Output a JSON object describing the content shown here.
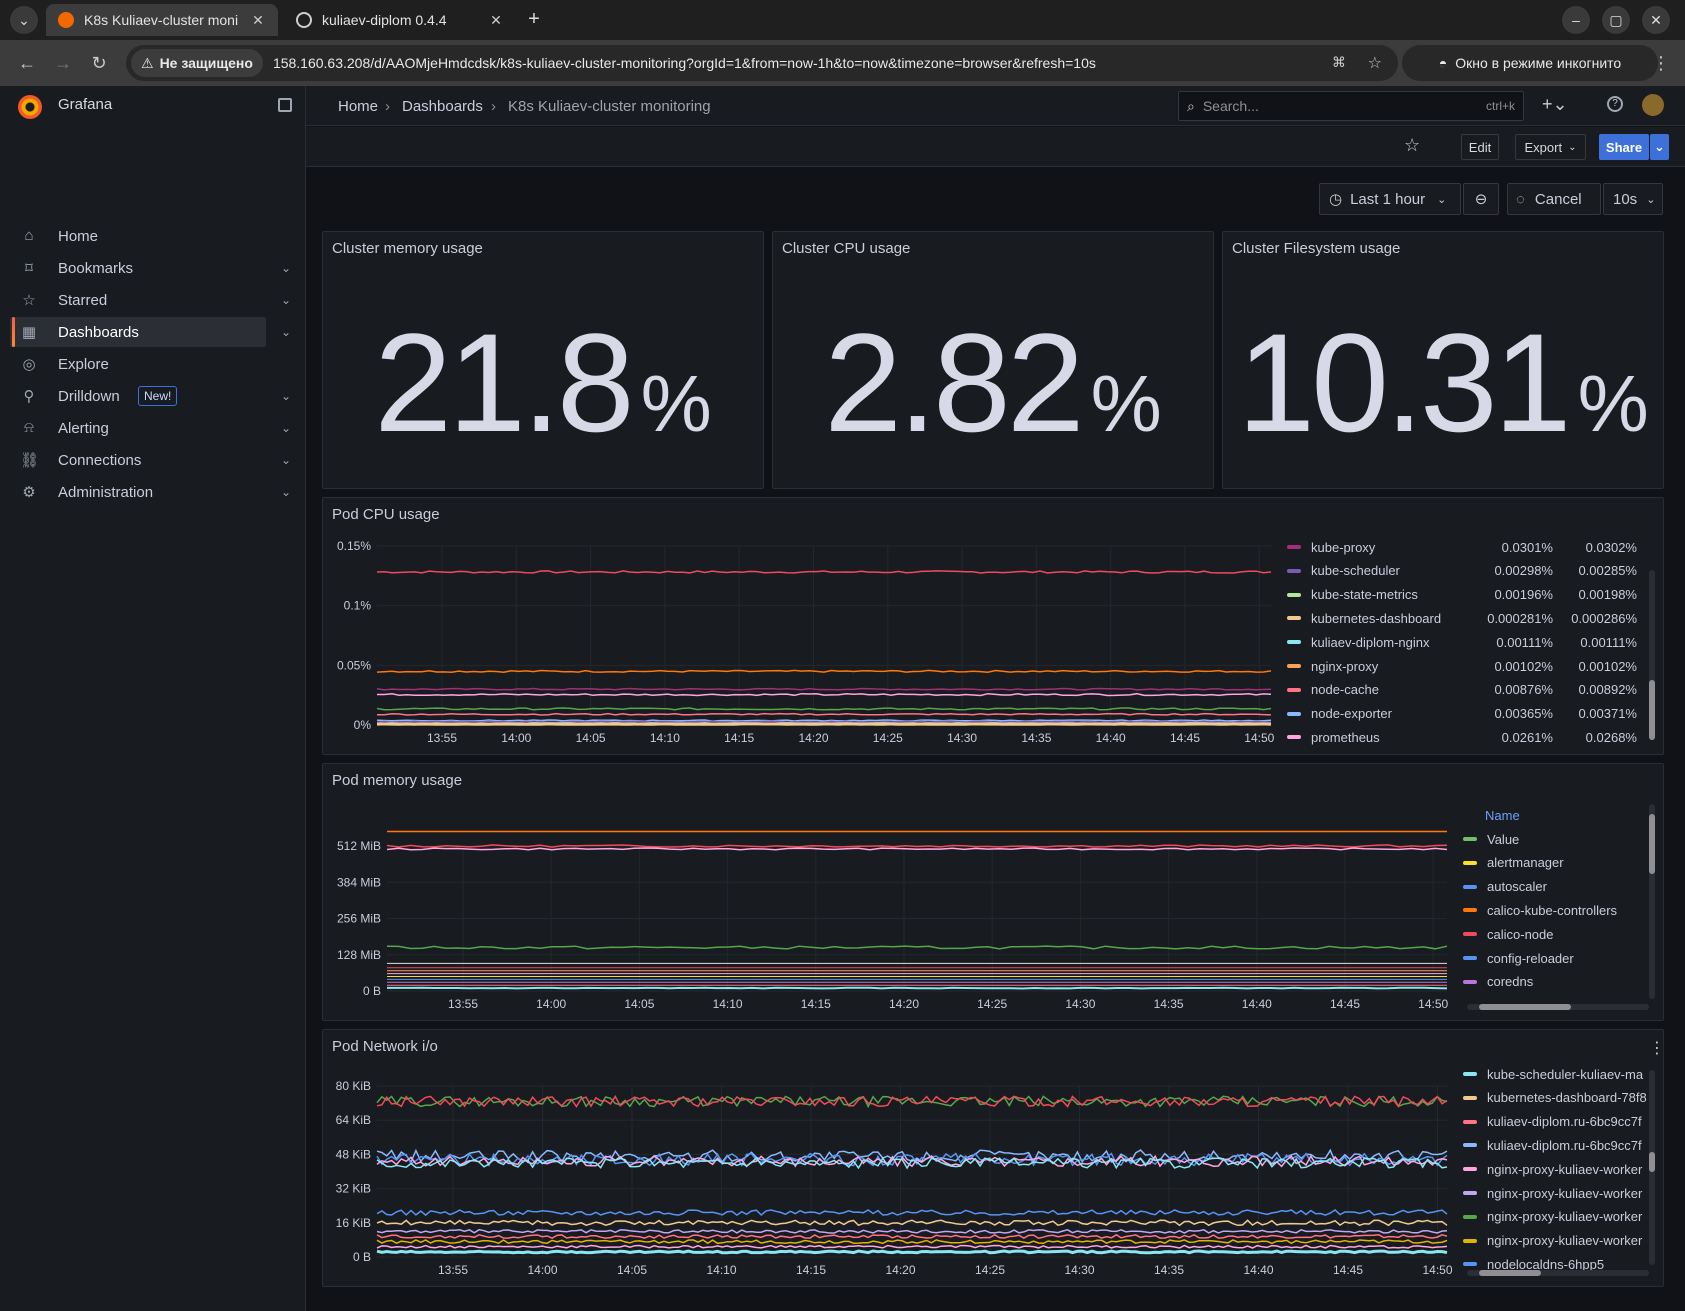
{
  "browser": {
    "tabs": [
      {
        "title": "K8s Kuliaev-cluster moni",
        "active": true
      },
      {
        "title": "kuliaev-diplom 0.4.4",
        "active": false
      }
    ],
    "security_label": "Не защищено",
    "url": "158.160.63.208/d/AAOMjeHmdcdsk/k8s-kuliaev-cluster-monitoring?orgId=1&from=now-1h&to=now&timezone=browser&refresh=10s",
    "incognito_label": "Окно в режиме инкогнито"
  },
  "sidebar": {
    "brand": "Grafana",
    "items": [
      {
        "label": "Home",
        "icon": "home-icon",
        "chevron": false
      },
      {
        "label": "Bookmarks",
        "icon": "bookmark-icon",
        "chevron": true
      },
      {
        "label": "Starred",
        "icon": "star-icon",
        "chevron": true
      },
      {
        "label": "Dashboards",
        "icon": "dashboards-grid-icon",
        "chevron": true,
        "active": true
      },
      {
        "label": "Explore",
        "icon": "compass-icon",
        "chevron": false
      },
      {
        "label": "Drilldown",
        "icon": "drilldown-icon",
        "chevron": true,
        "badge": "New!"
      },
      {
        "label": "Alerting",
        "icon": "bell-icon",
        "chevron": true
      },
      {
        "label": "Connections",
        "icon": "connections-icon",
        "chevron": true
      },
      {
        "label": "Administration",
        "icon": "gear-icon",
        "chevron": true
      }
    ]
  },
  "topbar": {
    "breadcrumb": [
      "Home",
      "Dashboards",
      "K8s Kuliaev-cluster monitoring"
    ],
    "search_placeholder": "Search...",
    "search_shortcut": "ctrl+k"
  },
  "toolbar": {
    "edit": "Edit",
    "export": "Export",
    "share": "Share",
    "time_range": "Last 1 hour",
    "cancel": "Cancel",
    "refresh": "10s"
  },
  "stats": [
    {
      "title": "Cluster memory usage",
      "value": "21.8",
      "unit": "%"
    },
    {
      "title": "Cluster CPU usage",
      "value": "2.82",
      "unit": "%"
    },
    {
      "title": "Cluster Filesystem usage",
      "value": "10.31",
      "unit": "%"
    }
  ],
  "x_ticks": [
    "13:55",
    "14:00",
    "14:05",
    "14:10",
    "14:15",
    "14:20",
    "14:25",
    "14:30",
    "14:35",
    "14:40",
    "14:45",
    "14:50"
  ],
  "cpu_panel": {
    "title": "Pod CPU usage",
    "y_ticks": [
      "0.15%",
      "0.1%",
      "0.05%",
      "0%"
    ],
    "legend": [
      {
        "name": "kube-proxy",
        "a": "0.0301%",
        "b": "0.0302%",
        "color": "#a0307a"
      },
      {
        "name": "kube-scheduler",
        "a": "0.00298%",
        "b": "0.00285%",
        "color": "#7a5bb8"
      },
      {
        "name": "kube-state-metrics",
        "a": "0.00196%",
        "b": "0.00198%",
        "color": "#b6e59a"
      },
      {
        "name": "kubernetes-dashboard",
        "a": "0.000281%",
        "b": "0.000286%",
        "color": "#f2c98f"
      },
      {
        "name": "kuliaev-diplom-nginx",
        "a": "0.00111%",
        "b": "0.00111%",
        "color": "#8ae6f0"
      },
      {
        "name": "nginx-proxy",
        "a": "0.00102%",
        "b": "0.00102%",
        "color": "#ff9f5a"
      },
      {
        "name": "node-cache",
        "a": "0.00876%",
        "b": "0.00892%",
        "color": "#ff7383"
      },
      {
        "name": "node-exporter",
        "a": "0.00365%",
        "b": "0.00371%",
        "color": "#8ab8ff"
      },
      {
        "name": "prometheus",
        "a": "0.0261%",
        "b": "0.0268%",
        "color": "#ffa6e0"
      }
    ]
  },
  "mem_panel": {
    "title": "Pod memory usage",
    "y_ticks": [
      "512 MiB",
      "384 MiB",
      "256 MiB",
      "128 MiB",
      "0 B"
    ],
    "legend_header": "Name",
    "legend": [
      {
        "name": "Value",
        "color": "#73bf69"
      },
      {
        "name": "alertmanager",
        "color": "#fade2a"
      },
      {
        "name": "autoscaler",
        "color": "#5794f2"
      },
      {
        "name": "calico-kube-controllers",
        "color": "#ff780a"
      },
      {
        "name": "calico-node",
        "color": "#f2495c"
      },
      {
        "name": "config-reloader",
        "color": "#5794f2"
      },
      {
        "name": "coredns",
        "color": "#b877d9"
      }
    ]
  },
  "net_panel": {
    "title": "Pod Network i/o",
    "y_ticks": [
      "80 KiB",
      "64 KiB",
      "48 KiB",
      "32 KiB",
      "16 KiB",
      "0 B"
    ],
    "legend": [
      {
        "name": "kube-scheduler-kuliaev-ma",
        "color": "#8ae6f0"
      },
      {
        "name": "kubernetes-dashboard-78f8",
        "color": "#f2c98f"
      },
      {
        "name": "kuliaev-diplom.ru-6bc9cc7f",
        "color": "#ff7383"
      },
      {
        "name": "kuliaev-diplom.ru-6bc9cc7f",
        "color": "#8ab8ff"
      },
      {
        "name": "nginx-proxy-kuliaev-worker",
        "color": "#ffa6e0"
      },
      {
        "name": "nginx-proxy-kuliaev-worker",
        "color": "#c0a8f0"
      },
      {
        "name": "nginx-proxy-kuliaev-worker",
        "color": "#56a64b"
      },
      {
        "name": "nginx-proxy-kuliaev-worker",
        "color": "#e0b400"
      },
      {
        "name": "nodelocaldns-6hpp5",
        "color": "#5794f2"
      }
    ]
  }
}
